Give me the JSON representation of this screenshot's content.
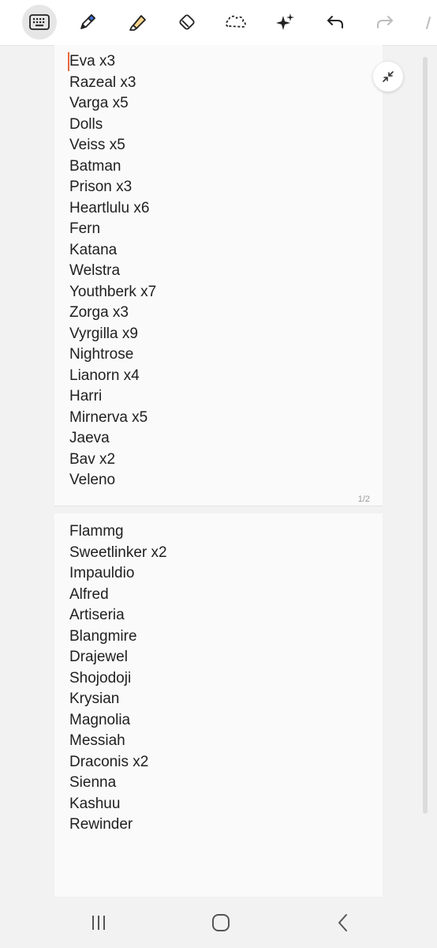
{
  "toolbar": {
    "tools": [
      {
        "name": "keyboard-icon",
        "active": true
      },
      {
        "name": "pen-icon"
      },
      {
        "name": "highlighter-icon"
      },
      {
        "name": "eraser-icon"
      },
      {
        "name": "lasso-icon"
      },
      {
        "name": "sparkle-icon"
      },
      {
        "name": "undo-icon"
      },
      {
        "name": "redo-icon",
        "disabled": true
      }
    ]
  },
  "page1": {
    "lines": [
      "Eva x3",
      "Razeal x3",
      "Varga x5",
      "Dolls",
      "Veiss x5",
      "Batman",
      "Prison x3",
      "Heartlulu x6",
      "Fern",
      "Katana",
      "Welstra",
      "Youthberk x7",
      "Zorga x3",
      "Vyrgilla x9",
      "Nightrose",
      "Lianorn x4",
      "Harri",
      "Mirnerva x5",
      "Jaeva",
      "Bav x2",
      "Veleno"
    ],
    "page_number": "1/2"
  },
  "page2": {
    "lines": [
      "Flammg",
      "Sweetlinker x2",
      "Impauldio",
      "Alfred",
      "Artiseria",
      "Blangmire",
      "Drajewel",
      "Shojodoji",
      "Krysian",
      "Magnolia",
      "Messiah",
      "Draconis x2",
      "Sienna",
      "Kashuu",
      "Rewinder"
    ]
  },
  "colors": {
    "cursor": "#e8683f",
    "highlighter": "#f7d58a",
    "pen": "#3d6fd8"
  },
  "navbar": {
    "buttons": [
      "recent-apps-icon",
      "home-icon",
      "back-icon"
    ]
  }
}
